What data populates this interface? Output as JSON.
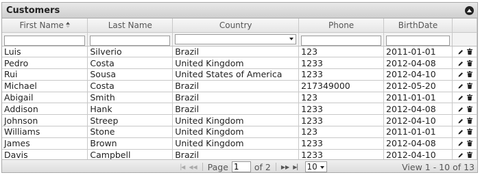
{
  "caption": {
    "title": "Customers",
    "collapse_icon": "collapse-up-icon"
  },
  "columns": [
    "First Name",
    "Last Name",
    "Country",
    "Phone",
    "BirthDate"
  ],
  "sort": {
    "column": "First Name",
    "icon": "sort-asc-icon"
  },
  "filters": {
    "country_select_value": ""
  },
  "rows": [
    [
      "Luis",
      "Silverio",
      "Brazil",
      "123",
      "2011-01-01"
    ],
    [
      "Pedro",
      "Costa",
      "United Kingdom",
      "1233",
      "2012-04-08"
    ],
    [
      "Rui",
      "Sousa",
      "United States of America",
      "1233",
      "2012-04-10"
    ],
    [
      "Michael",
      "Costa",
      "Brazil",
      "217349000",
      "2012-05-20"
    ],
    [
      "Abigail",
      "Smith",
      "Brazil",
      "123",
      "2011-01-01"
    ],
    [
      "Addison",
      "Hank",
      "Brazil",
      "1233",
      "2012-04-08"
    ],
    [
      "Johnson",
      "Streep",
      "United Kingdom",
      "1233",
      "2012-04-10"
    ],
    [
      "Williams",
      "Stone",
      "United Kingdom",
      "123",
      "2011-01-01"
    ],
    [
      "James",
      "Brown",
      "United Kingdom",
      "1233",
      "2012-04-08"
    ],
    [
      "Davis",
      "Campbell",
      "Brazil",
      "1233",
      "2012-04-10"
    ]
  ],
  "row_action_icons": [
    "edit-icon",
    "delete-icon"
  ],
  "pager": {
    "page_label": "Page",
    "page_value": "1",
    "of_label": "of 2",
    "rows_per_page": "10",
    "view_info": "View 1 - 10 of 13"
  }
}
